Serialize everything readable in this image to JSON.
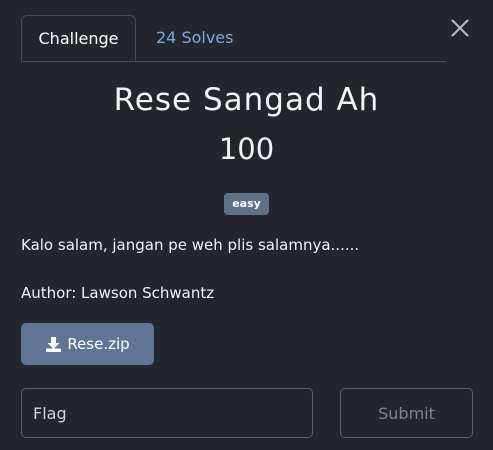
{
  "tabs": {
    "challenge_label": "Challenge",
    "solves_label": "24 Solves"
  },
  "close_icon": "close-icon",
  "challenge": {
    "name": "Rese Sangad Ah",
    "points": "100",
    "tag": "easy",
    "description": "Kalo salam, jangan pe weh plis salamnya......",
    "author": "Author: Lawson Schwantz"
  },
  "download": {
    "icon": "download-icon",
    "label": "Rese.zip"
  },
  "flag": {
    "value": "",
    "placeholder": "Flag"
  },
  "submit": {
    "label": "Submit"
  },
  "colors": {
    "background": "#23262c",
    "tab_link": "#7aa9e8",
    "badge": "#5f7089",
    "download_button": "#5f7594",
    "border": "#494f57"
  }
}
